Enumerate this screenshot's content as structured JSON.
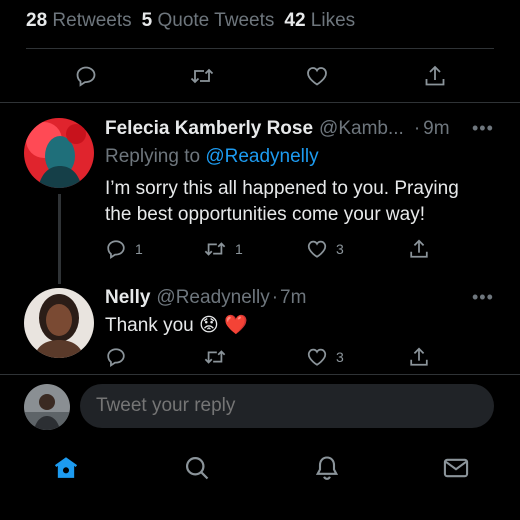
{
  "stats": {
    "retweets_count": "28",
    "retweets_label": "Retweets",
    "quotes_count": "5",
    "quotes_label": "Quote Tweets",
    "likes_count": "42",
    "likes_label": "Likes"
  },
  "replies": [
    {
      "name": "Felecia Kamberly Rose",
      "handle": "@Kamb...",
      "time": "9m",
      "replying_prefix": "Replying to",
      "replying_handle": "@Readynelly",
      "text": "I’m sorry this all happened to you. Praying the best opportunities come your way!",
      "reply_count": "1",
      "retweet_count": "1",
      "like_count": "3"
    },
    {
      "name": "Nelly",
      "handle": "@Readynelly",
      "time": "7m",
      "text": "Thank you 😟 ❤️",
      "like_count": "3"
    }
  ],
  "composer": {
    "placeholder": "Tweet your reply"
  },
  "colors": {
    "background": "#000000",
    "accent": "#1d9bf0",
    "muted": "#6e767d"
  },
  "tabs": [
    "home-icon",
    "search-icon",
    "notifications-icon",
    "messages-icon"
  ]
}
